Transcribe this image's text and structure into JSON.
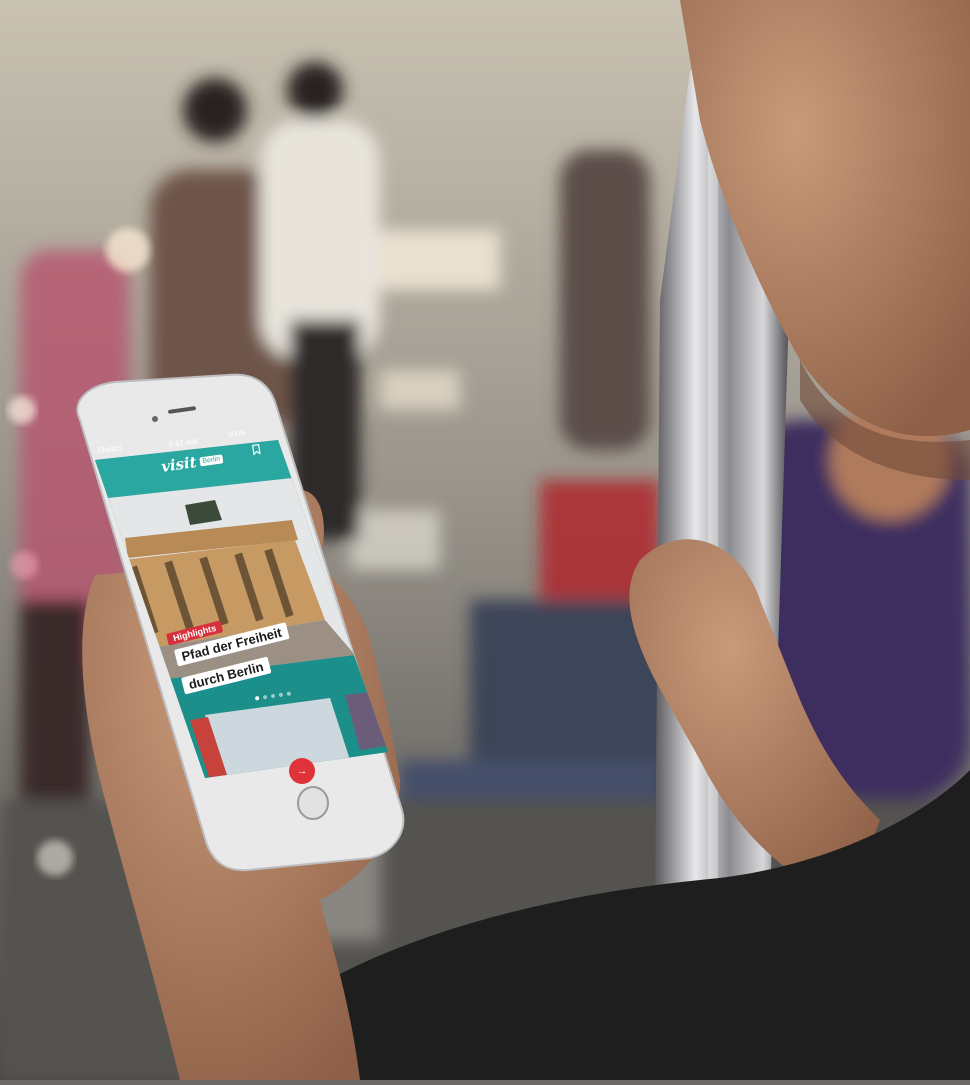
{
  "photo": {
    "description_tags": [
      "subway-interior",
      "person-holding-phone",
      "metal-pole",
      "seated-passengers"
    ]
  },
  "status_bar": {
    "carrier": "Sketch",
    "time": "9:41 AM",
    "battery": "100%"
  },
  "app": {
    "logo_text": "visit",
    "logo_badge": "Berlin",
    "hero": {
      "badge": "Highlights",
      "title_line1": "Pfad der Freiheit",
      "title_line2": "durch Berlin"
    },
    "carousel": {
      "dots": 5,
      "active": 0
    }
  },
  "colors": {
    "app_teal": "#2aa7a1",
    "badge_red": "#d6303c",
    "fab_red": "#e0323a"
  },
  "icons": {
    "bookmark": "bookmark-icon",
    "arrow": "arrow-right-icon"
  }
}
